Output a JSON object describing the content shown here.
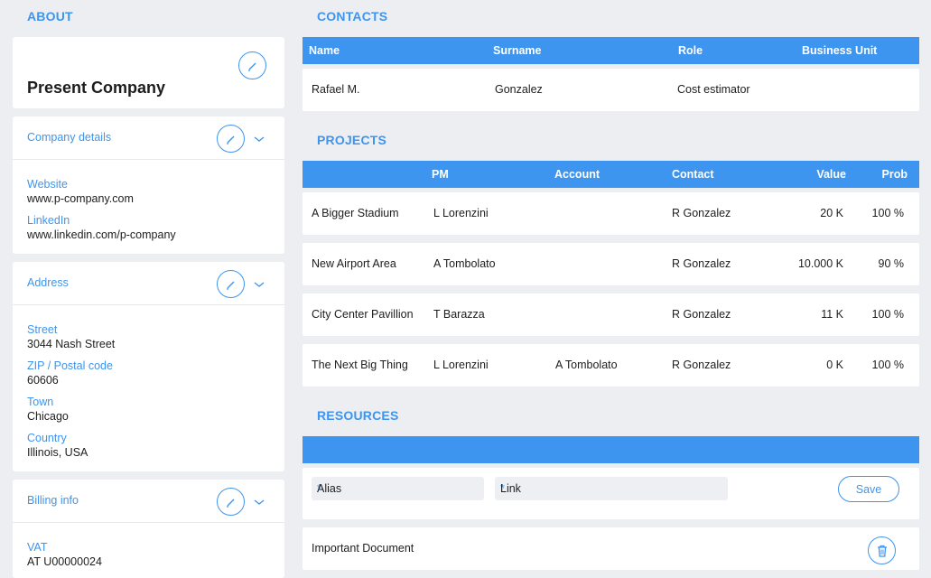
{
  "about": {
    "title": "ABOUT",
    "company_name": "Present Company",
    "company_details": {
      "label": "Company details",
      "website_label": "Website",
      "website": "www.p-company.com",
      "linkedin_label": "LinkedIn",
      "linkedin": "www.linkedin.com/p-company"
    },
    "address": {
      "label": "Address",
      "street_label": "Street",
      "street": "3044 Nash Street",
      "zip_label": "ZIP / Postal code",
      "zip": "60606",
      "town_label": "Town",
      "town": "Chicago",
      "country_label": "Country",
      "country": "Illinois, USA"
    },
    "billing": {
      "label": "Billing info",
      "vat_label": "VAT",
      "vat": "AT U00000024"
    }
  },
  "contacts": {
    "title": "CONTACTS",
    "columns": [
      "Name",
      "Surname",
      "Role",
      "Business Unit"
    ],
    "rows": [
      {
        "name": "Rafael M.",
        "surname": "Gonzalez",
        "role": "Cost estimator",
        "unit": ""
      }
    ]
  },
  "projects": {
    "title": "PROJECTS",
    "columns": [
      "",
      "PM",
      "Account",
      "Contact",
      "Value",
      "Prob"
    ],
    "rows": [
      {
        "name": "A Bigger Stadium",
        "pm": "L Lorenzini",
        "account": "",
        "contact": "R Gonzalez",
        "value": "20 K",
        "prob": "100 %"
      },
      {
        "name": "New Airport Area",
        "pm": "A Tombolato",
        "account": "",
        "contact": "R Gonzalez",
        "value": "10.000 K",
        "prob": "90 %"
      },
      {
        "name": "City Center Pavillion",
        "pm": "T Barazza",
        "account": "",
        "contact": "R Gonzalez",
        "value": "11 K",
        "prob": "100 %"
      },
      {
        "name": "The Next Big Thing",
        "pm": "L Lorenzini",
        "account": "A Tombolato",
        "contact": "R Gonzalez",
        "value": "0 K",
        "prob": "100 %"
      }
    ]
  },
  "resources": {
    "title": "RESOURCES",
    "alias_placeholder": "Alias",
    "link_placeholder": "Link",
    "required_mark": "*",
    "save_label": "Save",
    "items": [
      {
        "label": "Important Document"
      }
    ]
  },
  "icons": {
    "edit": "pencil-icon",
    "expand": "chevron-down-icon",
    "delete": "trash-icon"
  },
  "colors": {
    "accent": "#3d95ef",
    "background": "#eceef1"
  }
}
